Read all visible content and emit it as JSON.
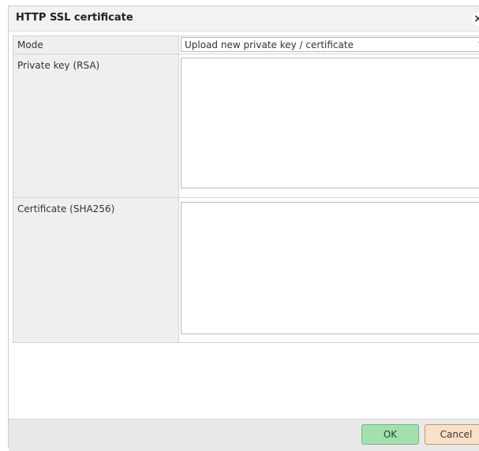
{
  "dialog": {
    "title": "HTTP SSL certificate",
    "close_label": "×"
  },
  "form": {
    "mode": {
      "label": "Mode",
      "selected": "Upload new private key / certificate"
    },
    "private_key": {
      "label": "Private key (RSA)",
      "value": ""
    },
    "certificate": {
      "label": "Certificate (SHA256)",
      "value": ""
    }
  },
  "footer": {
    "ok_label": "OK",
    "cancel_label": "Cancel"
  },
  "icons": {
    "close": "close-icon",
    "dropdown": "chevron-down-icon"
  },
  "colors": {
    "titlebar_bg": "#f2f2f2",
    "label_bg": "#efefef",
    "ok_button": "#a6dfae",
    "cancel_button": "#f7e1c9"
  }
}
